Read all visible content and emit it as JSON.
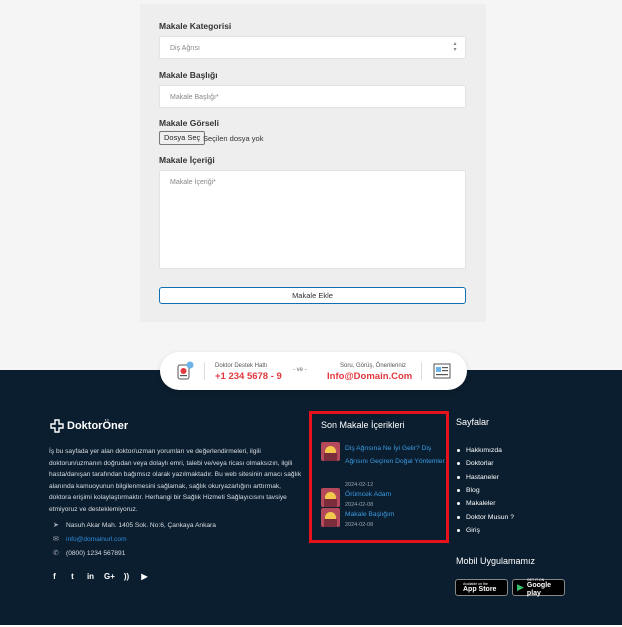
{
  "form": {
    "category_label": "Makale Kategorisi",
    "category_value": "Diş Ağrısı",
    "title_label": "Makale Başlığı",
    "title_placeholder": "Makale Başlığı*",
    "image_label": "Makale Görseli",
    "file_button": "Dosya Seç",
    "file_status": "Seçilen dosya yok",
    "content_label": "Makale İçeriği",
    "content_placeholder": "Makale İçeriği*",
    "submit": "Makale Ekle"
  },
  "contact": {
    "hotline_label": "Doktor Destek Hattı",
    "hotline_number": "+1 234 5678 - 9",
    "separator": "- ve -",
    "feedback_label": "Soru, Görüş, Önerileriniz",
    "feedback_email": "Info@Domain.Com"
  },
  "footer": {
    "logo_text": "DoktorÖner",
    "about": "İş bu sayfada yer alan doktor/uzman yorumları ve değerlendirmeleri, ilgili doktorun/uzmanın doğrudan veya dolaylı emri, talebi ve/veya ricası olmaksızın, ilgili hasta/danışan tarafından bağımsız olarak yazılmaktadır. Bu web sitesinin amacı sağlık alanında kamuoyunun bilgilenmesini sağlamak, sağlık okuryazarlığını arttırmak, doktora erişimi kolaylaştırmaktır. Herhangi bir Sağlık Hizmeti Sağlayıcısını tavsiye etmiyoruz ve desteklemiyoruz.",
    "address": "Nasuh Akar Mah. 1405 Sok. No:6, Çankaya Ankara",
    "email": "info@domainurl.com",
    "phone": "(0800) 1234 567891",
    "recent_title": "Son Makale İçerikleri",
    "recent": [
      {
        "title": "Diş Ağrısına Ne İyi Gelir? Diş Ağrısını Geçiren Doğal Yöntemler",
        "date": "2024-02-12"
      },
      {
        "title": "Örümcek Adam",
        "date": "2024-02-08"
      },
      {
        "title": "Makale Başlığım",
        "date": "2024-02-08"
      }
    ],
    "pages_title": "Sayfalar",
    "pages": [
      "Hakkımızda",
      "Doktorlar",
      "Hastaneler",
      "Blog",
      "Makaleler",
      "Doktor Musun ?",
      "Giriş"
    ],
    "mobile_title": "Mobil Uygulamamız",
    "appstore_small": "Available on the",
    "appstore_big": "App Store",
    "googleplay_small": "GET IT ON",
    "googleplay_big": "Google play"
  }
}
